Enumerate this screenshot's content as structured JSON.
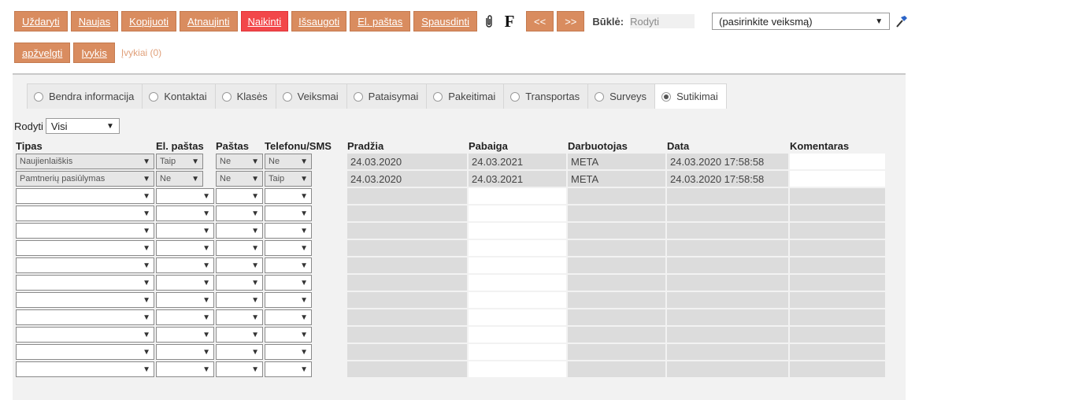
{
  "toolbar": {
    "close": "Uždaryti",
    "new": "Naujas",
    "copy": "Kopijuoti",
    "refresh": "Atnaujinti",
    "delete": "Naikinti",
    "save": "Išsaugoti",
    "email": "El. paštas",
    "print": "Spausdinti",
    "attach_icon": "paperclip-icon",
    "f_label": "F",
    "prev": "<<",
    "next": ">>",
    "status_label": "Būklė:",
    "status_value": "Rodyti",
    "action_select": "(pasirinkite veiksmą)",
    "hammer_icon": "hammer-icon"
  },
  "toolbar2": {
    "review": "apžvelgti",
    "event": "Įvykis",
    "events_link": "Įvykiai (0)"
  },
  "tabs": [
    {
      "label": "Bendra informacija",
      "active": false
    },
    {
      "label": "Kontaktai",
      "active": false
    },
    {
      "label": "Klasės",
      "active": false
    },
    {
      "label": "Veiksmai",
      "active": false
    },
    {
      "label": "Pataisymai",
      "active": false
    },
    {
      "label": "Pakeitimai",
      "active": false
    },
    {
      "label": "Transportas",
      "active": false
    },
    {
      "label": "Surveys",
      "active": false
    },
    {
      "label": "Sutikimai",
      "active": true
    }
  ],
  "filter": {
    "label": "Rodyti",
    "value": "Visi"
  },
  "table": {
    "headers": [
      "Tipas",
      "El. paštas",
      "Paštas",
      "Telefonu/SMS",
      "Pradžia",
      "Pabaiga",
      "Darbuotojas",
      "Data",
      "Komentaras"
    ],
    "rows": [
      {
        "tipas": "Naujienlaiškis",
        "email": "Taip",
        "post": "Ne",
        "phone": "Ne",
        "start": "24.03.2020",
        "end": "24.03.2021",
        "employee": "META",
        "date": "24.03.2020 17:58:58",
        "comment": ""
      },
      {
        "tipas": "Pamtnerių pasiūlymas",
        "email": "Ne",
        "post": "Ne",
        "phone": "Taip",
        "start": "24.03.2020",
        "end": "24.03.2021",
        "employee": "META",
        "date": "24.03.2020 17:58:58",
        "comment": ""
      }
    ],
    "empty_rows": 11
  },
  "colors": {
    "button": "#d98c5f",
    "delete_button": "#f2474a",
    "panel_bg": "#f2f2f2"
  }
}
